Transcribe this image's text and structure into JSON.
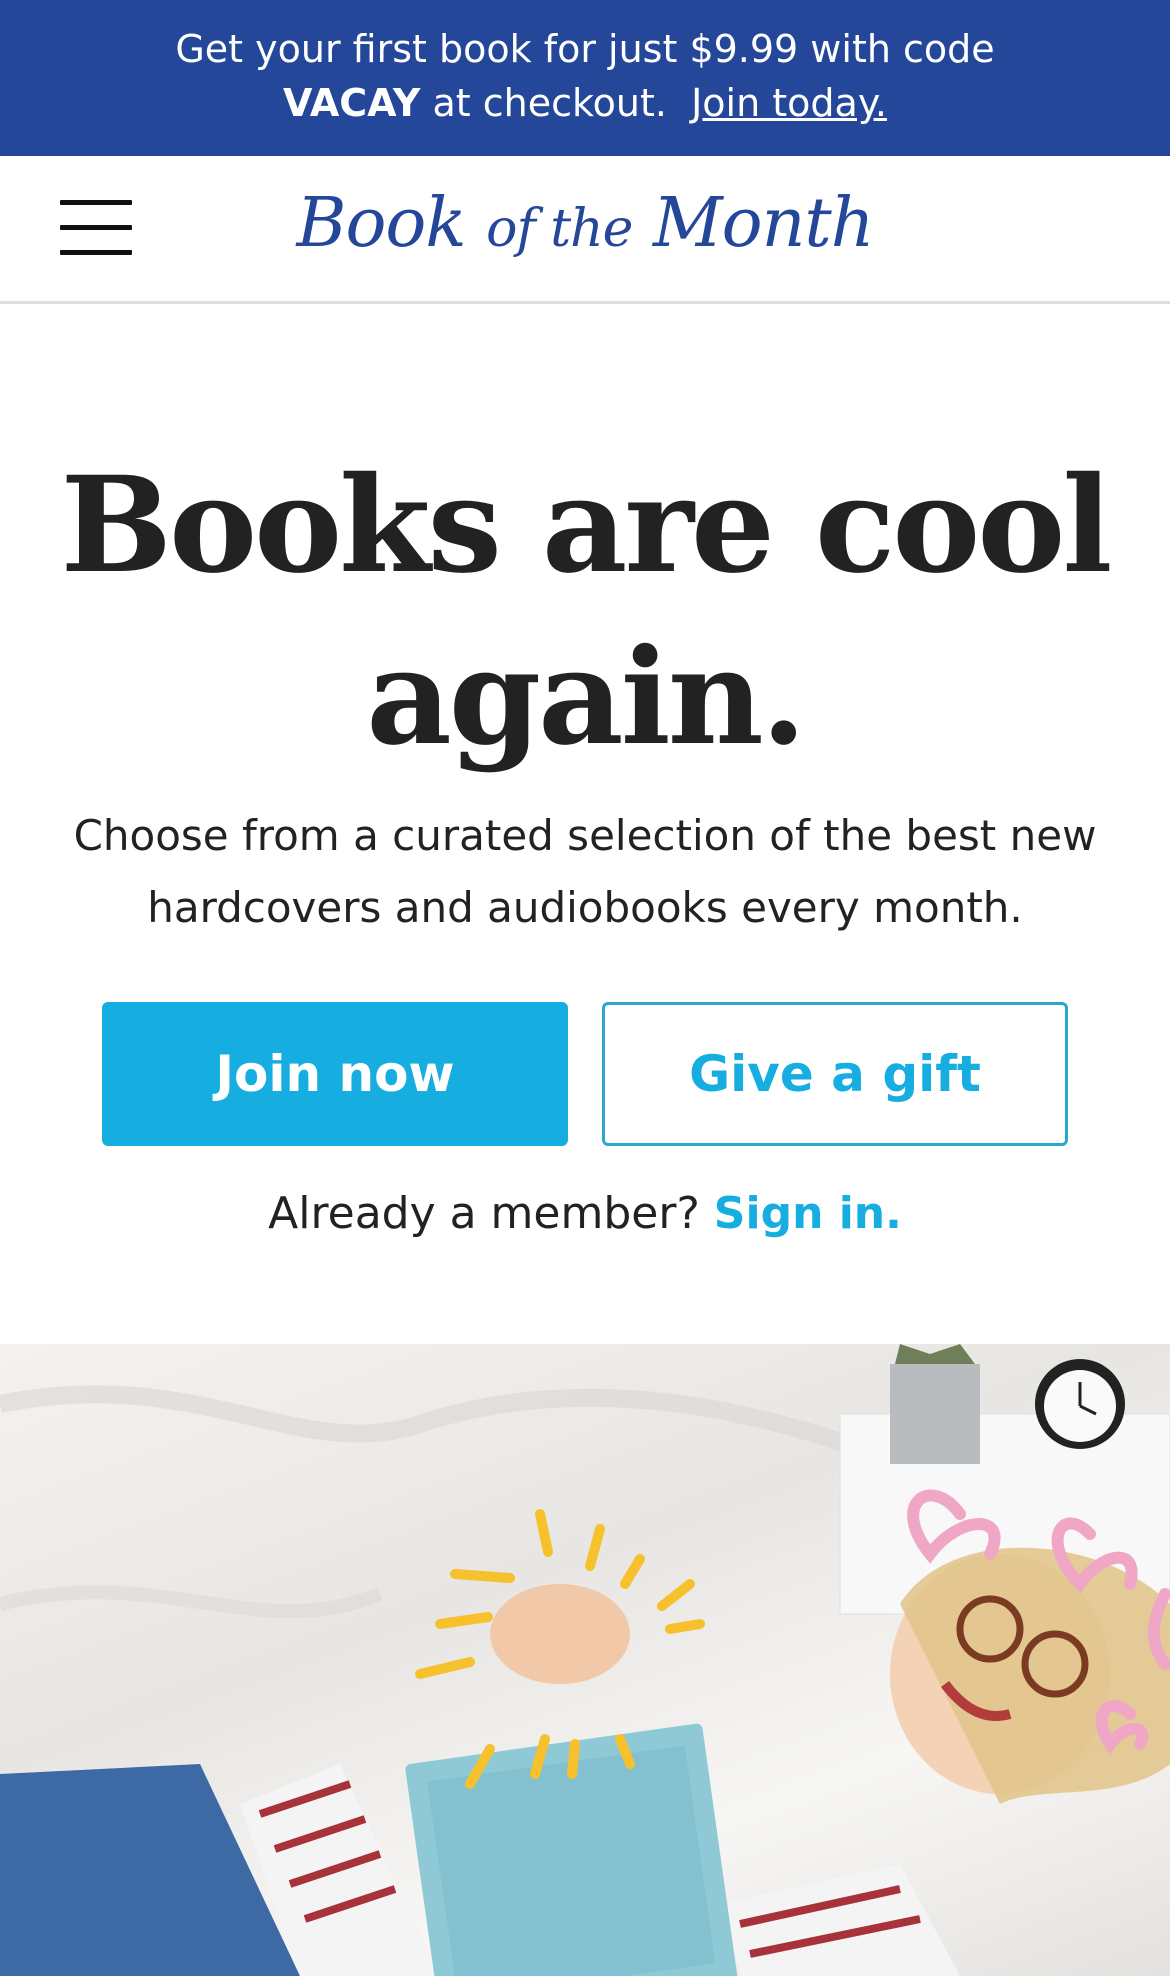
{
  "promo": {
    "line1": "Get your first book for just $9.99 with code",
    "code": "VACAY",
    "line2": "at checkout.",
    "link": "Join today."
  },
  "header": {
    "logo_book": "Book",
    "logo_of_the": "of the",
    "logo_month": "Month",
    "menu_icon": "hamburger-menu-icon"
  },
  "hero": {
    "title_line1": "Books are cool",
    "title_line2": "again.",
    "subtitle_line1": "Choose from a curated selection of the best new",
    "subtitle_line2": "hardcovers and audiobooks every month."
  },
  "actions": {
    "join_label": "Join now",
    "gift_label": "Give a gift"
  },
  "member": {
    "prompt": "Already a member?",
    "signin": "Sign in."
  },
  "colors": {
    "promo_bg": "#24479a",
    "brand_blue": "#24479a",
    "accent": "#16ade0",
    "text": "#222222"
  }
}
